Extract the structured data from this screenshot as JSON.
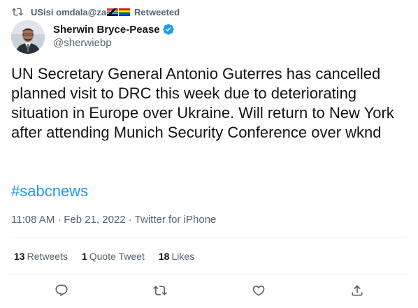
{
  "retweet_bar": {
    "label": "USisi omdala@za",
    "suffix": "Retweeted",
    "icon": "retweet-icon"
  },
  "author": {
    "name": "Sherwin Bryce-Pease",
    "handle": "@sherwiebp",
    "verified_icon": "verified-badge-icon",
    "accent": "#1d9bf0"
  },
  "tweet": {
    "text": "UN Secretary General Antonio Guterres has cancelled planned visit to DRC this week due to deteriorating situation in Europe over Ukraine. Will return to New York after attending Munich Security Conference over wknd",
    "hashtag": "#sabcnews"
  },
  "meta": {
    "time": "11:08 AM",
    "date": "Feb 21, 2022",
    "source": "Twitter for iPhone",
    "sep": "·"
  },
  "stats": {
    "retweets_count": "13",
    "retweets_label": "Retweets",
    "quotes_count": "1",
    "quotes_label": "Quote Tweet",
    "likes_count": "18",
    "likes_label": "Likes"
  },
  "actions": {
    "reply_icon": "reply-icon",
    "retweet_icon": "retweet-icon",
    "like_icon": "heart-icon",
    "share_icon": "share-icon"
  }
}
